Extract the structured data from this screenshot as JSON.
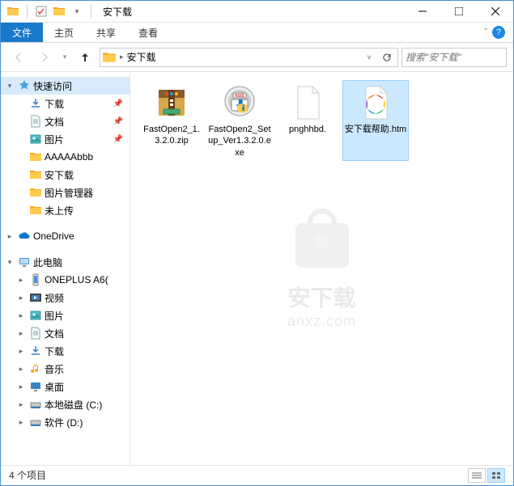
{
  "window": {
    "title": "安下载",
    "minimize": "—",
    "maximize": "☐",
    "close": "✕"
  },
  "ribbon": {
    "file": "文件",
    "home": "主页",
    "share": "共享",
    "view": "查看",
    "expand": "ˇ"
  },
  "nav": {
    "breadcrumb": "安下载",
    "search_placeholder": "搜索\"安下载\""
  },
  "tree": {
    "quick_access": "快速访问",
    "downloads": "下载",
    "documents": "文档",
    "pictures": "图片",
    "folder_a": "AAAAAbbb",
    "folder_b": "安下载",
    "folder_c": "图片管理器",
    "folder_d": "未上传",
    "onedrive": "OneDrive",
    "this_pc": "此电脑",
    "oneplus": "ONEPLUS A6(",
    "videos": "视频",
    "pictures2": "图片",
    "documents2": "文档",
    "downloads2": "下载",
    "music": "音乐",
    "desktop": "桌面",
    "disk_c": "本地磁盘 (C:)",
    "disk_d": "软件 (D:)"
  },
  "files": [
    {
      "name": "FastOpen2_1.3.2.0.zip",
      "icon": "zip",
      "selected": false
    },
    {
      "name": "FastOpen2_Setup_Ver1.3.2.0.exe",
      "icon": "installer",
      "selected": false
    },
    {
      "name": "pnghhbd.",
      "icon": "blank",
      "selected": false
    },
    {
      "name": "安下载帮助.htm",
      "icon": "htm",
      "selected": true
    }
  ],
  "watermark": {
    "text": "安下载",
    "url": "anxz.com"
  },
  "status": {
    "count": "4 个项目"
  }
}
